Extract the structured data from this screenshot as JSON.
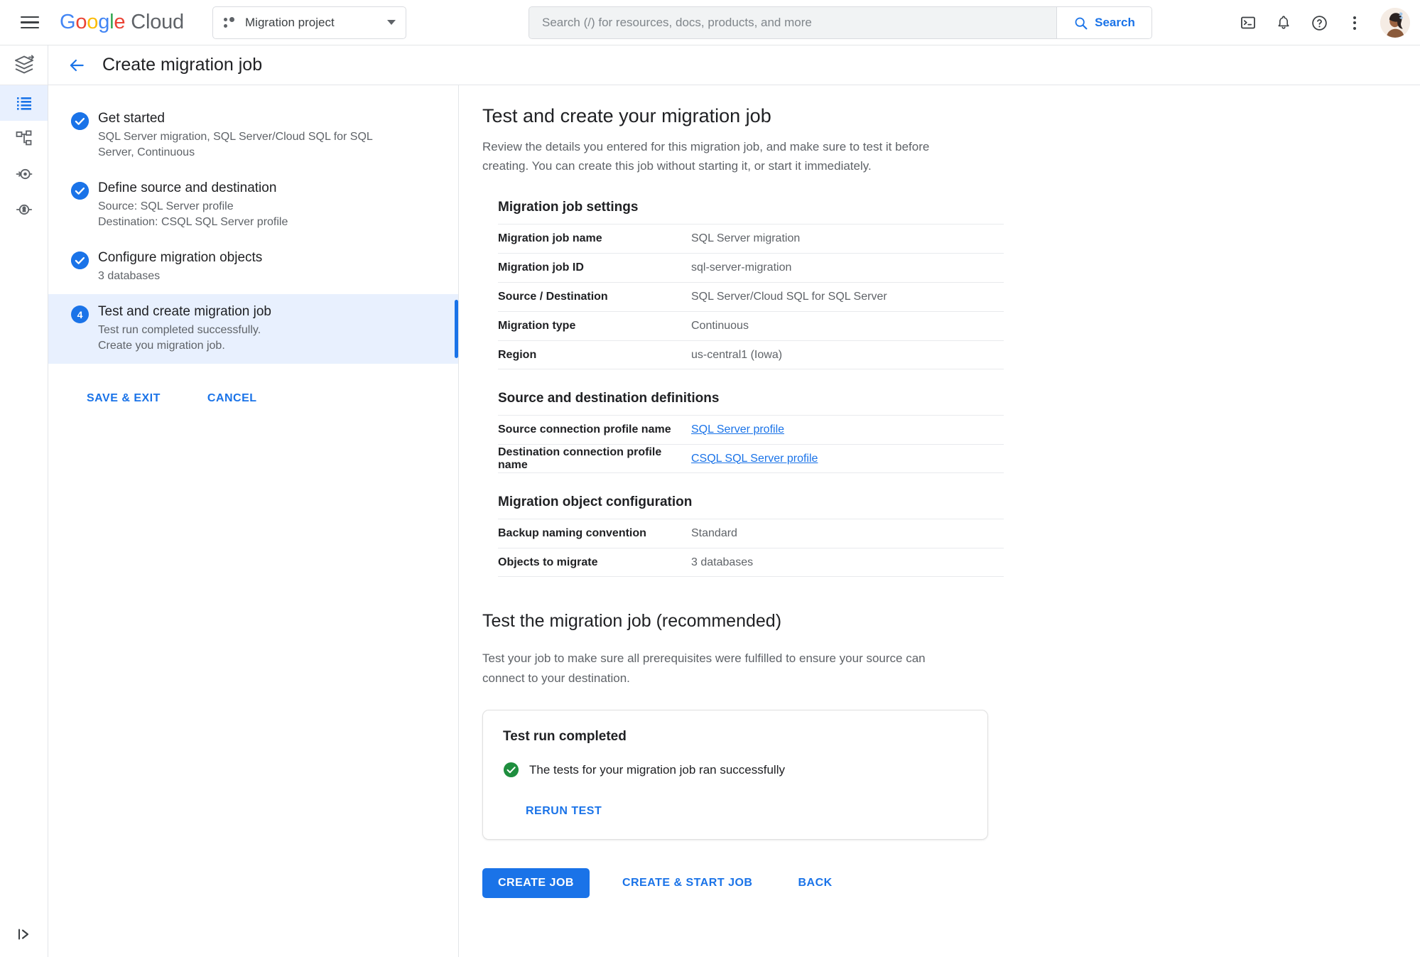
{
  "topbar": {
    "brand": "Google Cloud",
    "brand_letters": [
      "G",
      "o",
      "o",
      "g",
      "l",
      "e"
    ],
    "brand_suffix": "Cloud",
    "project_name": "Migration project",
    "search_placeholder": "Search (/) for resources, docs, products, and more",
    "search_value": "",
    "search_button": "Search",
    "icons": [
      "menu-icon",
      "cloud-shell-icon",
      "notifications-bell-icon",
      "help-circle-icon",
      "more-vert-icon",
      "avatar"
    ]
  },
  "rail": {
    "product_icon": "database-migration-service-icon",
    "items": [
      {
        "icon": "migration-jobs-list-icon",
        "active": true
      },
      {
        "icon": "connection-profiles-icon",
        "active": false
      },
      {
        "icon": "private-connectivity-icon",
        "active": false
      },
      {
        "icon": "conversion-workspace-icon",
        "active": false
      }
    ],
    "expand_icon": "expand-panel-icon"
  },
  "page": {
    "back_icon": "back-arrow-icon",
    "title": "Create migration job"
  },
  "steps": {
    "items": [
      {
        "state": "done",
        "number": "1",
        "title": "Get started",
        "sub": "SQL Server migration, SQL Server/Cloud SQL for SQL Server, Continuous"
      },
      {
        "state": "done",
        "number": "2",
        "title": "Define source and destination",
        "sub": "Source: SQL Server profile\nDestination: CSQL SQL Server profile"
      },
      {
        "state": "done",
        "number": "3",
        "title": "Configure migration objects",
        "sub": "3 databases"
      },
      {
        "state": "active",
        "number": "4",
        "title": "Test and create migration job",
        "sub": "Test run completed successfully.\nCreate you migration job."
      }
    ],
    "save_exit_label": "SAVE & EXIT",
    "cancel_label": "CANCEL"
  },
  "main": {
    "heading": "Test and create your migration job",
    "lead": "Review the details you entered for this migration job, and make sure to test it before creating. You can create this job without starting it, or start it immediately.",
    "sections": [
      {
        "title": "Migration job settings",
        "rows": [
          {
            "key": "Migration job name",
            "value": "SQL Server migration",
            "link": false
          },
          {
            "key": "Migration job ID",
            "value": "sql-server-migration",
            "link": false
          },
          {
            "key": "Source / Destination",
            "value": "SQL Server/Cloud SQL for SQL Server",
            "link": false
          },
          {
            "key": "Migration type",
            "value": "Continuous",
            "link": false
          },
          {
            "key": "Region",
            "value": "us-central1 (Iowa)",
            "link": false
          }
        ]
      },
      {
        "title": "Source and destination definitions",
        "rows": [
          {
            "key": "Source connection profile name",
            "value": "SQL Server profile",
            "link": true
          },
          {
            "key": "Destination connection profile name",
            "value": "CSQL SQL Server profile",
            "link": true
          }
        ]
      },
      {
        "title": "Migration object configuration",
        "rows": [
          {
            "key": "Backup naming convention",
            "value": "Standard",
            "link": false
          },
          {
            "key": "Objects to migrate",
            "value": "3 databases",
            "link": false
          }
        ]
      }
    ],
    "test_heading": "Test the migration job (recommended)",
    "test_para": "Test your job to make sure all prerequisites were fulfilled to ensure your source can connect to your destination.",
    "test_card": {
      "title": "Test run completed",
      "status_icon": "check-circle-icon",
      "status_message": "The tests for your migration job ran successfully",
      "rerun_label": "RERUN TEST"
    },
    "actions": {
      "create_job": "CREATE JOB",
      "create_start_job": "CREATE & START JOB",
      "back": "BACK"
    }
  },
  "colors": {
    "accent_blue": "#1a73e8",
    "active_step_bg": "#e8f0fe",
    "success_green": "#1e8e3e",
    "text_primary": "#202124",
    "text_secondary": "#5f6368",
    "border": "#e0e0e0"
  }
}
